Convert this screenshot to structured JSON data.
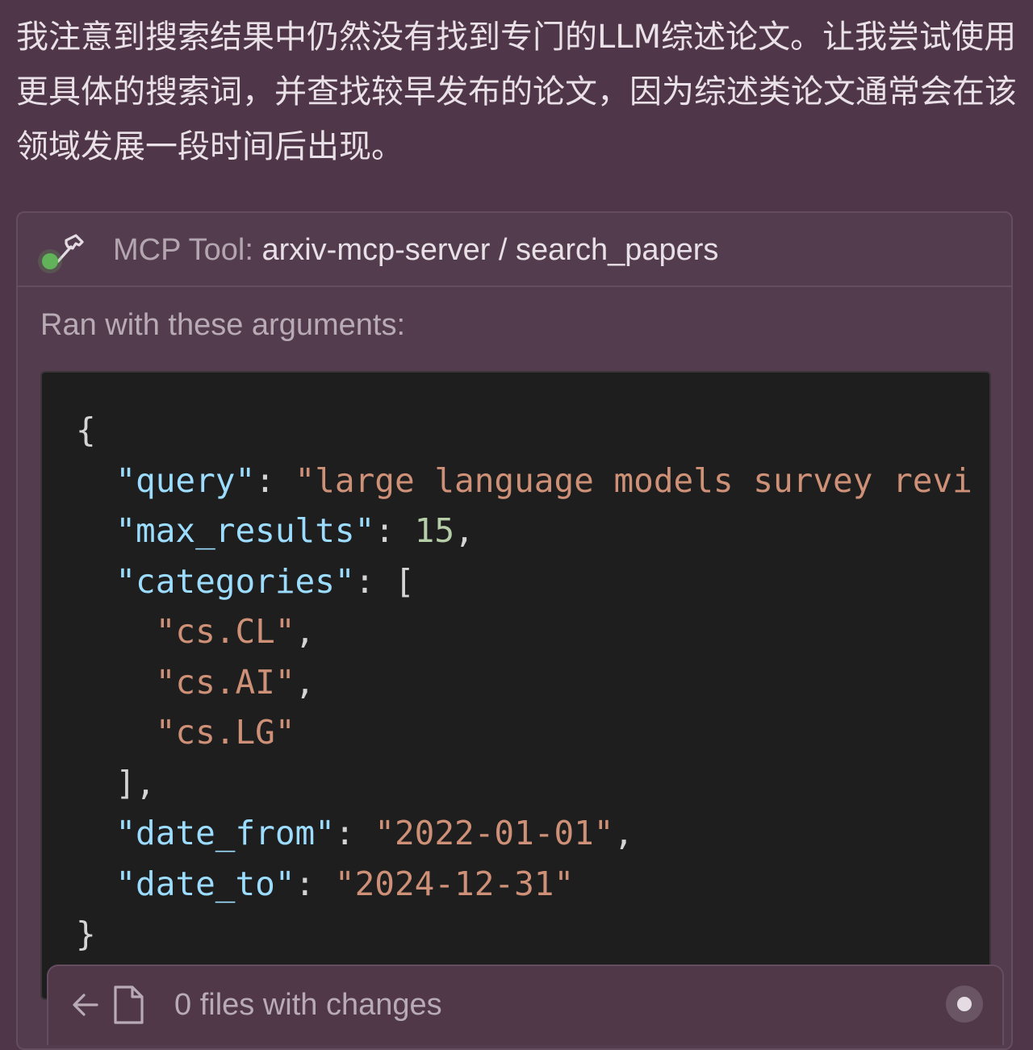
{
  "message": {
    "text": "我注意到搜索结果中仍然没有找到专门的LLM综述论文。让我尝试使用更具体的搜索词，并查找较早发布的论文，因为综述类论文通常会在该领域发展一段时间后出现。"
  },
  "tool_call": {
    "title_prefix": "MCP Tool: ",
    "server": "arxiv-mcp-server",
    "separator": " / ",
    "tool_name": "search_papers",
    "args_label": "Ran with these arguments:",
    "status_color": "#62b25a",
    "icon": "hammer-icon",
    "arguments": {
      "query_key": "\"query\"",
      "query_value": "\"large language models survey revi",
      "max_results_key": "\"max_results\"",
      "max_results_value": "15",
      "categories_key": "\"categories\"",
      "categories": [
        "\"cs.CL\"",
        "\"cs.AI\"",
        "\"cs.LG\""
      ],
      "date_from_key": "\"date_from\"",
      "date_from_value": "\"2022-01-01\"",
      "date_to_key": "\"date_to\"",
      "date_to_value": "\"2024-12-31\""
    }
  },
  "bottom_bar": {
    "changes_label": "0 files with changes",
    "back_icon": "arrow-left-icon",
    "file_icon": "file-icon"
  },
  "colors": {
    "background": "#4f3648",
    "code_background": "#1e1e1e",
    "json_key": "#9cdcfe",
    "json_string": "#ce9178",
    "json_number": "#b5cea8"
  }
}
